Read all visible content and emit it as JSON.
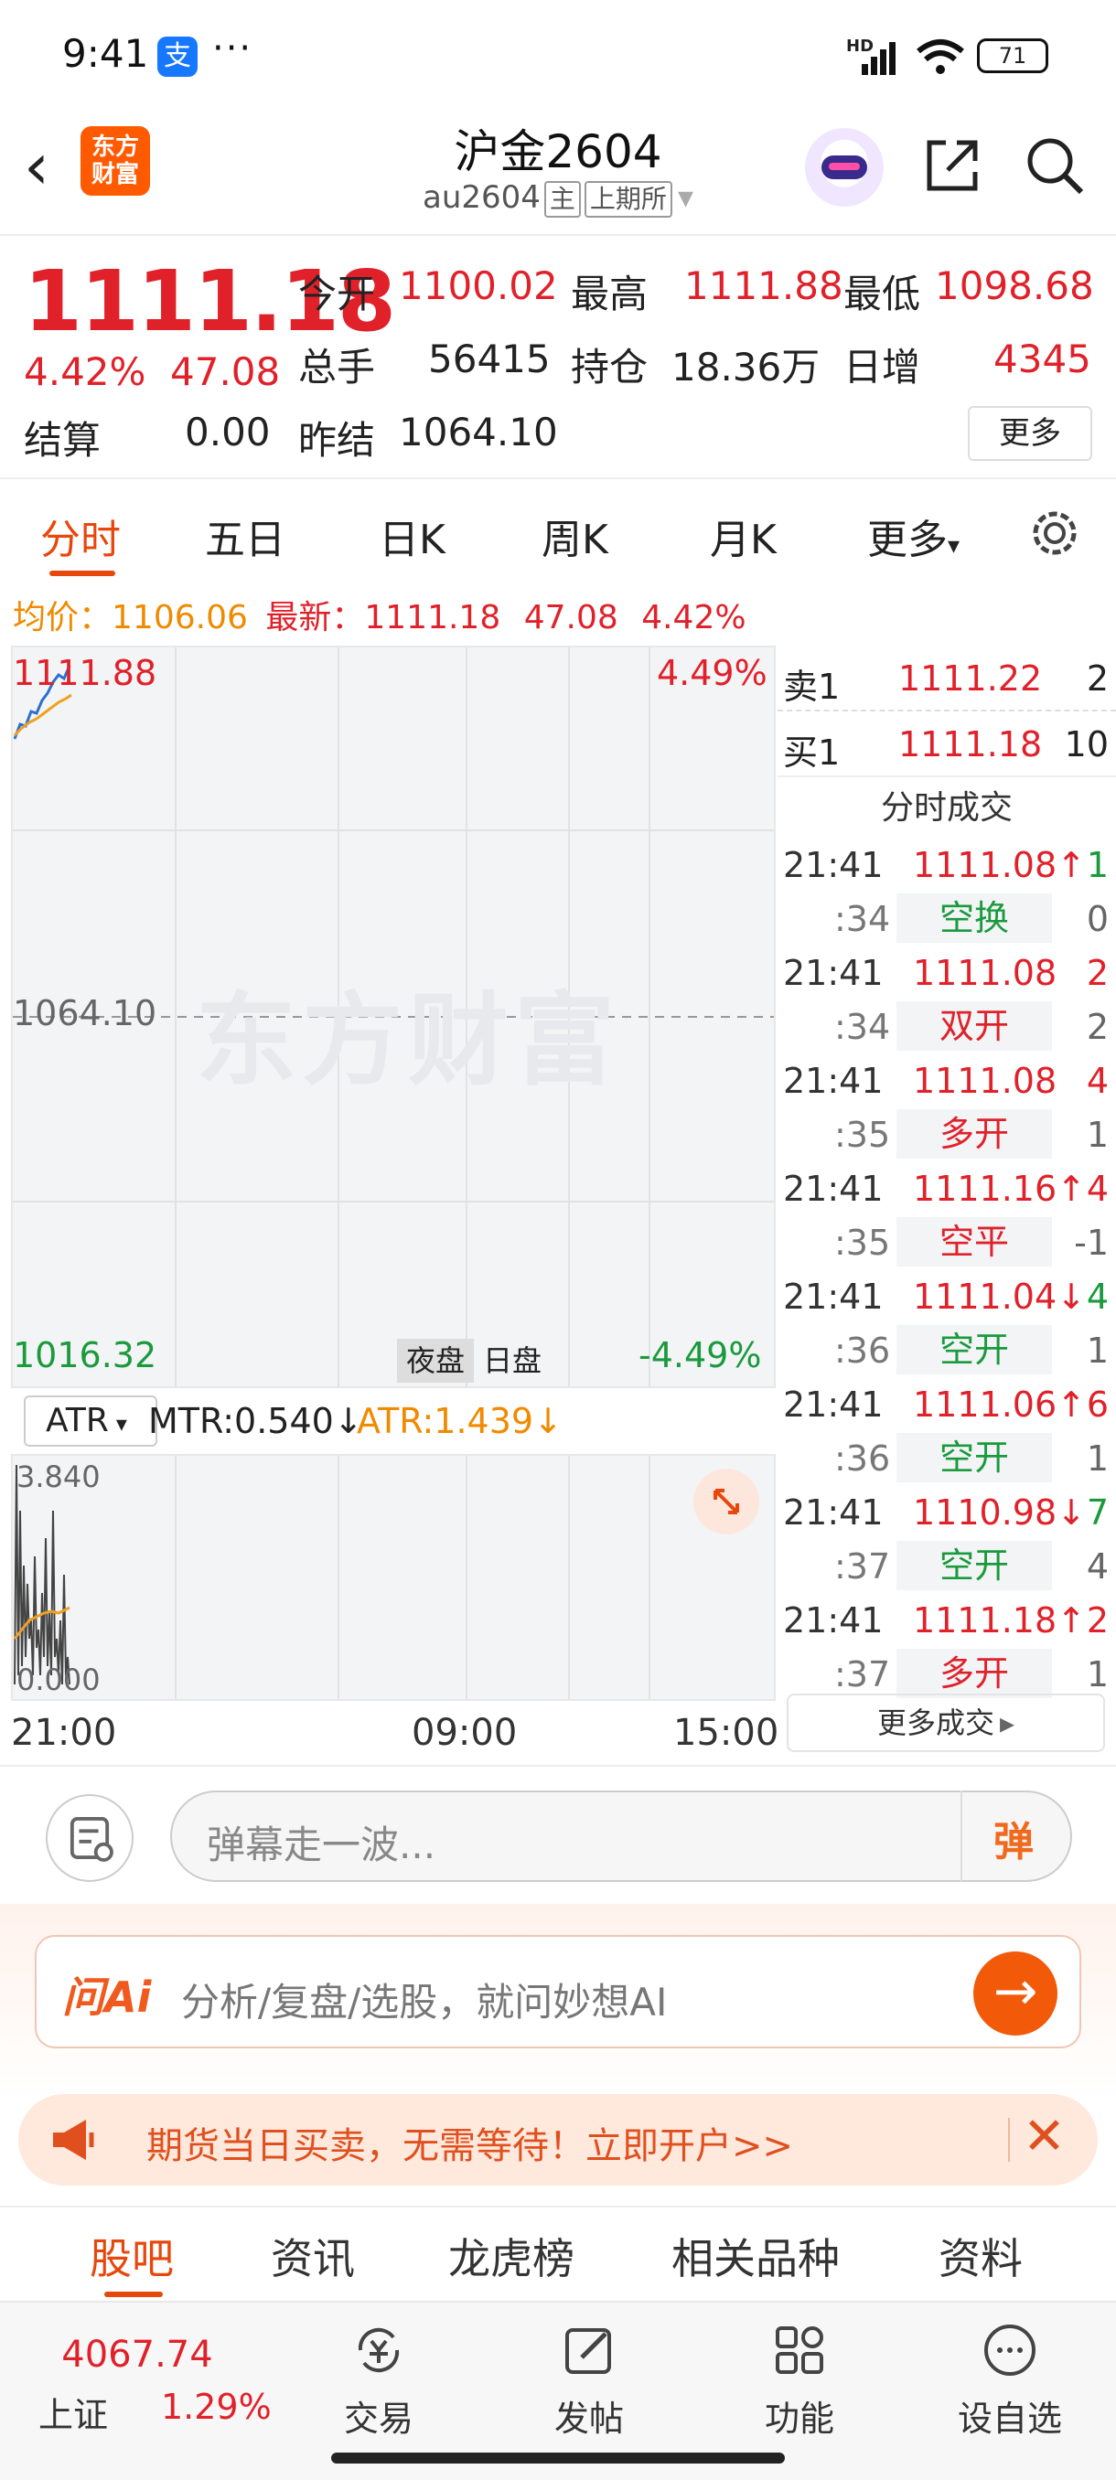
{
  "status": {
    "time": "9:41",
    "alipay_glyph": "支",
    "dots": "···",
    "hd": "HD",
    "battery": "71"
  },
  "header": {
    "back_glyph": "‹",
    "logo_text": "东方财富",
    "title": "沪金2604",
    "code": "au2604",
    "tag_main": "主",
    "tag_exchange": "上期所",
    "dropdown_glyph": "▾",
    "icons": [
      "back-icon",
      "robot-avatar-icon",
      "share-icon",
      "search-icon"
    ]
  },
  "quote": {
    "price": "1111.18",
    "change_pct": "4.42%",
    "change": "47.08",
    "fields": [
      {
        "label": "今开",
        "value": "1100.02"
      },
      {
        "label": "最高",
        "value": "1111.88"
      },
      {
        "label": "最低",
        "value": "1098.68"
      },
      {
        "label": "总手",
        "value": "56415"
      },
      {
        "label": "持仓",
        "value": "18.36万"
      },
      {
        "label": "日增",
        "value": "4345"
      },
      {
        "label": "结算",
        "value": "0.00"
      },
      {
        "label": "昨结",
        "value": "1064.10"
      }
    ],
    "more_label": "更多",
    "colors": {
      "up": "#e0212a",
      "down": "#1a9a3c",
      "avg": "#f08a00",
      "accent": "#e8470c"
    }
  },
  "tabs": {
    "items": [
      "分时",
      "五日",
      "日K",
      "周K",
      "月K"
    ],
    "more": "更多",
    "more_glyph": "▾",
    "active": 0
  },
  "infoline": {
    "avg_label": "均价：",
    "avg": "1106.06",
    "latest_label": "最新：",
    "latest": "1111.18",
    "change": "47.08",
    "pct": "4.42%"
  },
  "chart": {
    "top_value": "1111.88",
    "top_pct": "4.49%",
    "mid_value": "1064.10",
    "bottom_value": "1016.32",
    "bottom_pct": "-4.49%",
    "watermark": "东方财富",
    "session_night": "夜盘",
    "session_day": "日盘"
  },
  "indicator": {
    "name": "ATR",
    "dropdown_glyph": "▾",
    "mtr_label": "MTR:0.540",
    "mtr_arrow": "↓",
    "atr_label": "ATR:1.439",
    "atr_arrow": "↓",
    "sub_top": "3.840",
    "sub_bottom": "0.000"
  },
  "time_axis": [
    "21:00",
    "09:00",
    "15:00"
  ],
  "order_book": {
    "sell": {
      "label": "卖1",
      "price": "1111.22",
      "volume": "2"
    },
    "buy": {
      "label": "买1",
      "price": "1111.18",
      "volume": "10"
    }
  },
  "trades": {
    "title": "分时成交",
    "rows": [
      {
        "time": "21:41",
        "price": "1111.08↑",
        "vol": "1",
        "color": "red",
        "vcolor": "green"
      },
      {
        "time": ":34",
        "price": "空换",
        "vol": "0",
        "color": "green",
        "kind": true,
        "vcolor": "gray"
      },
      {
        "time": "21:41",
        "price": "1111.08",
        "vol": "2",
        "color": "red",
        "vcolor": "red"
      },
      {
        "time": ":34",
        "price": "双开",
        "vol": "2",
        "color": "red",
        "kind": true,
        "vcolor": "gray"
      },
      {
        "time": "21:41",
        "price": "1111.08",
        "vol": "4",
        "color": "red",
        "vcolor": "red"
      },
      {
        "time": ":35",
        "price": "多开",
        "vol": "1",
        "color": "red",
        "kind": true,
        "vcolor": "gray"
      },
      {
        "time": "21:41",
        "price": "1111.16↑",
        "vol": "4",
        "color": "red",
        "vcolor": "red"
      },
      {
        "time": ":35",
        "price": "空平",
        "vol": "-1",
        "color": "red",
        "kind": true,
        "vcolor": "gray"
      },
      {
        "time": "21:41",
        "price": "1111.04↓",
        "vol": "4",
        "color": "red",
        "vcolor": "green"
      },
      {
        "time": ":36",
        "price": "空开",
        "vol": "1",
        "color": "green",
        "kind": true,
        "vcolor": "gray"
      },
      {
        "time": "21:41",
        "price": "1111.06↑",
        "vol": "6",
        "color": "red",
        "vcolor": "red"
      },
      {
        "time": ":36",
        "price": "空开",
        "vol": "1",
        "color": "green",
        "kind": true,
        "vcolor": "gray"
      },
      {
        "time": "21:41",
        "price": "1110.98↓",
        "vol": "7",
        "color": "red",
        "vcolor": "green"
      },
      {
        "time": ":37",
        "price": "空开",
        "vol": "4",
        "color": "green",
        "kind": true,
        "vcolor": "gray"
      },
      {
        "time": "21:41",
        "price": "1111.18↑",
        "vol": "2",
        "color": "red",
        "vcolor": "red"
      },
      {
        "time": ":37",
        "price": "多开",
        "vol": "1",
        "color": "red",
        "kind": true,
        "vcolor": "gray"
      }
    ],
    "more_label": "更多成交",
    "more_glyph": "▸"
  },
  "danmu": {
    "placeholder": "弹幕走一波...",
    "button": "弹"
  },
  "ai": {
    "logo": "问Ai",
    "placeholder": "分析/复盘/选股，就问妙想AI",
    "go_glyph": "→"
  },
  "promo": {
    "text": "期货当日买卖，无需等待！立即开户>>",
    "close_glyph": "✕"
  },
  "bottom_tabs": {
    "items": [
      "股吧",
      "资讯",
      "龙虎榜",
      "相关品种",
      "资料"
    ],
    "active": 0
  },
  "bottom_nav": {
    "index_value": "4067.74",
    "index_name": "上证",
    "index_pct": "1.29%",
    "items": [
      {
        "label": "交易",
        "icon": "trade-icon"
      },
      {
        "label": "发帖",
        "icon": "post-icon"
      },
      {
        "label": "功能",
        "icon": "grid-icon"
      },
      {
        "label": "设自选",
        "icon": "add-watchlist-icon"
      }
    ]
  }
}
